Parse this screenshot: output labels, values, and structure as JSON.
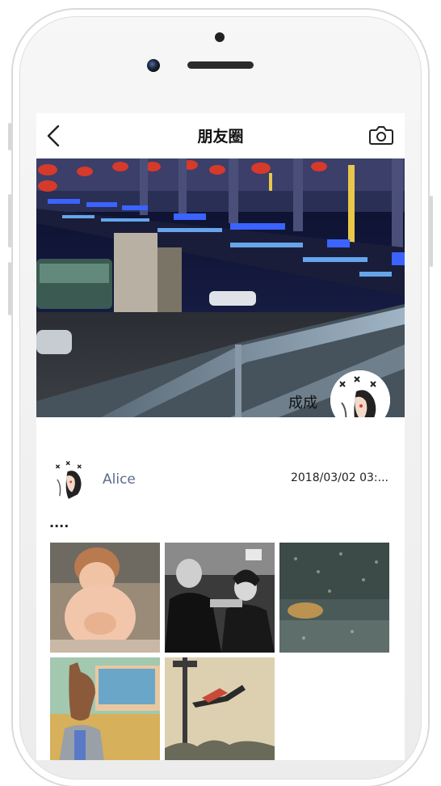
{
  "navbar": {
    "title": "朋友圈",
    "back_icon": "chevron-left-icon",
    "camera_icon": "camera-icon"
  },
  "cover": {
    "name": "成成"
  },
  "post": {
    "username": "Alice",
    "timestamp": "2018/03/02 03:...",
    "text": "....",
    "photos": [
      {
        "name": "photo-baby"
      },
      {
        "name": "photo-couple"
      },
      {
        "name": "photo-rainy-window"
      },
      {
        "name": "photo-cartoon-horse"
      },
      {
        "name": "photo-streetlamp-flight"
      }
    ]
  },
  "colors": {
    "username": "#5b6b8c",
    "navbar_bg": "#ffffff"
  }
}
